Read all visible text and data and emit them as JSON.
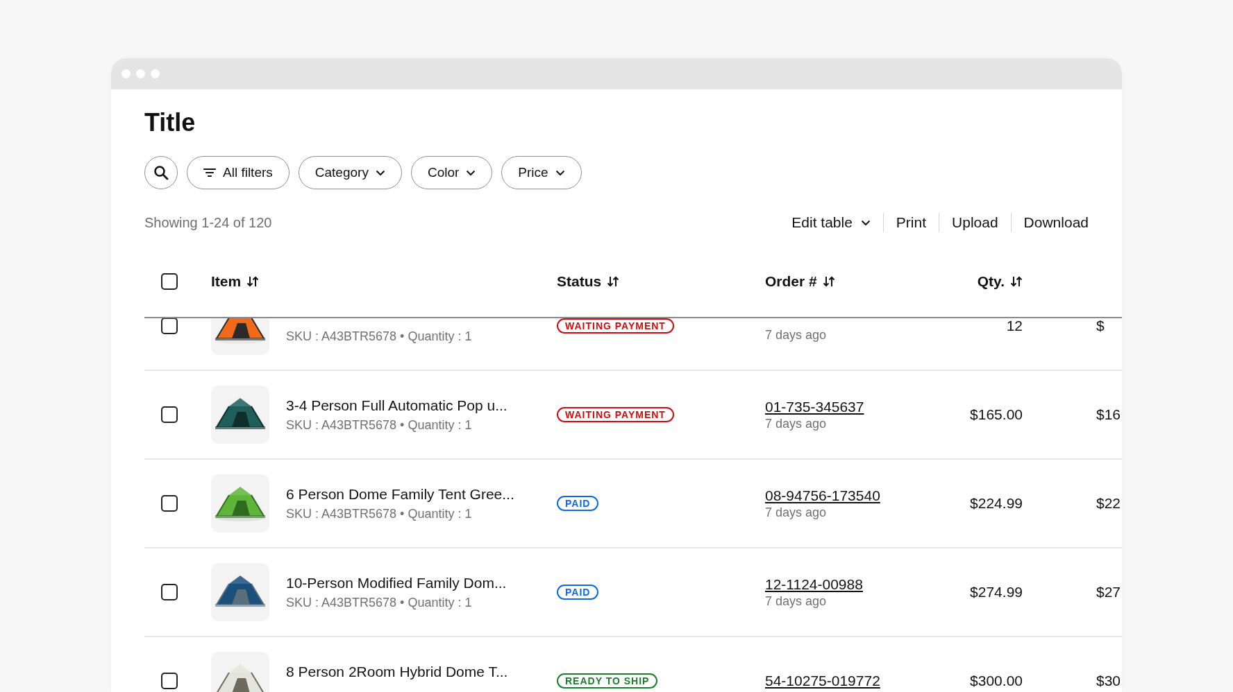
{
  "page": {
    "title": "Title"
  },
  "filters": [
    {
      "kind": "search"
    },
    {
      "kind": "all",
      "label": "All filters"
    },
    {
      "kind": "dropdown",
      "label": "Category"
    },
    {
      "kind": "dropdown",
      "label": "Color"
    },
    {
      "kind": "dropdown",
      "label": "Price"
    }
  ],
  "summary": "Showing 1-24 of 120",
  "actions": [
    {
      "label": "Edit table",
      "kind": "dropdown"
    },
    {
      "label": "Print",
      "kind": "plain"
    },
    {
      "label": "Upload",
      "kind": "plain"
    },
    {
      "label": "Download",
      "kind": "plain"
    }
  ],
  "table": {
    "select_all": {
      "checked": false
    },
    "columns": [
      {
        "label": "Item",
        "sortable": true
      },
      {
        "label": "Status",
        "sortable": true
      },
      {
        "label": "Order #",
        "sortable": true
      },
      {
        "label": "Qty.",
        "sortable": true
      }
    ],
    "rows": [
      {
        "checked": false,
        "sku": "SKU : A43BTR5678 • Quantity : 1",
        "status": {
          "label": "WAITING PAYMENT",
          "kind": "waiting"
        },
        "date": "7 days ago",
        "qty": "12",
        "column_6": "$"
      },
      {
        "checked": false,
        "title": "3-4 Person Full Automatic Pop u...",
        "sku": "SKU : A43BTR5678 • Quantity : 1",
        "status": {
          "label": "WAITING PAYMENT",
          "kind": "waiting"
        },
        "order": "01-735-345637",
        "date": "7 days ago",
        "qty": "$165.00",
        "column_6": "$16"
      },
      {
        "checked": false,
        "title": "6 Person Dome Family Tent Gree...",
        "sku": "SKU : A43BTR5678 • Quantity : 1",
        "status": {
          "label": "PAID",
          "kind": "paid"
        },
        "order": "08-94756-173540",
        "date": "7 days ago",
        "qty": "$224.99",
        "column_6": "$22"
      },
      {
        "checked": false,
        "title": "10-Person Modified Family Dom...",
        "sku": "SKU : A43BTR5678 • Quantity : 1",
        "status": {
          "label": "PAID",
          "kind": "paid"
        },
        "order": "12-1124-00988",
        "date": "7 days ago",
        "qty": "$274.99",
        "column_6": "$27"
      },
      {
        "checked": false,
        "title": "8 Person 2Room Hybrid Dome T...",
        "status": {
          "label": "READY TO SHIP",
          "kind": "ready"
        },
        "order": "54-10275-019772",
        "qty": "$300.00",
        "column_6": "$30"
      }
    ]
  }
}
